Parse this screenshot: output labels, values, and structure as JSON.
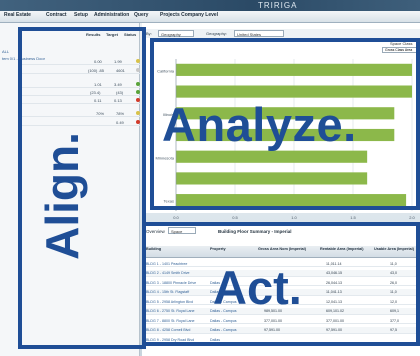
{
  "app": {
    "brand": "TRIRIGA"
  },
  "menubar": {
    "items": [
      "Real Estate",
      "Contract",
      "Setup",
      "Administration",
      "Query"
    ],
    "breadcrumb": "Projects Company Level"
  },
  "metrics_panel": {
    "columns": [
      "Results",
      "Target",
      "Status"
    ],
    "link_labels": [
      "ALL",
      "tem 0/1 - Business Door"
    ],
    "rows": [
      {
        "result": "0.00",
        "target": "1.99",
        "status_color": "#d8c24a"
      },
      {
        "result": "(100) .85",
        "target": "4601",
        "status_color": "#c8c8c8"
      },
      {
        "result": "1.01",
        "target": "3.49",
        "status_color": "#5aa33a"
      },
      {
        "result": "(23.4)",
        "target": "(43)",
        "status_color": "#5aa33a"
      },
      {
        "result": "0.11",
        "target": "0.13",
        "status_color": "#d23a2a"
      },
      {
        "result": "70%",
        "target": "78%",
        "status_color": "#d8c24a"
      },
      {
        "result": "",
        "target": "0.49",
        "status_color": "#d23a2a"
      }
    ]
  },
  "chart_panel": {
    "toolbar": {
      "filter_label": "By:",
      "filter_value": "Geography",
      "geo_label": "Geography:",
      "geo_value": "United States"
    },
    "flow_label": "Space Class",
    "flow_value": "Gross Class Area"
  },
  "chart_data": {
    "type": "bar",
    "orientation": "horizontal",
    "categories": [
      "California",
      "",
      "Illinois",
      "",
      "Minnesota",
      "",
      "Texas"
    ],
    "values": [
      2.05,
      2.0,
      1.85,
      1.85,
      1.62,
      1.62,
      1.95
    ],
    "xlim": [
      0,
      2.0
    ],
    "xticks": [
      "0.0",
      "0.5",
      "1.0",
      "1.5",
      "2.0"
    ],
    "series_color": "#8cb84a",
    "grid": true
  },
  "table_panel": {
    "view_label": "Overview",
    "view_value": "Space",
    "title": "Building Floor Summary - Imperial",
    "columns": [
      "Building",
      "Property",
      "Gross Area Nom (Imperial)",
      "Rentable Area (Imperial)",
      "Usable Area (Imperial)"
    ],
    "rows": [
      {
        "building": "BLDG 1 - 1401 Peachtree",
        "property": "",
        "gross": "",
        "rentable": "11,011.14",
        "usable": "11,0"
      },
      {
        "building": "BLDG 2 - 4149 Smith Drive",
        "property": "",
        "gross": "",
        "rentable": "43,046.15",
        "usable": "43,0"
      },
      {
        "building": "BLDG 3 - 18800 Pinnacle Drive",
        "property": "Dallas",
        "gross": "",
        "rentable": "26,044.13",
        "usable": "26,0"
      },
      {
        "building": "BLDG 4 - 15th St. Flagstaff",
        "property": "Dallas",
        "gross": "",
        "rentable": "11,041.13",
        "usable": "11,0"
      },
      {
        "building": "BLDG 5 - 2958 Arlington Blvd",
        "property": "Dallas - Campus",
        "gross": "",
        "rentable": "12,041.13",
        "usable": "12,0"
      },
      {
        "building": "BLDG 6 - 2750 St. Royal Lane",
        "property": "Dallas - Campus",
        "gross": "989,501.00",
        "rentable": "609,101.02",
        "usable": "609,1"
      },
      {
        "building": "BLDG 7 - 8800 St. Royal Lane",
        "property": "Dallas - Campus",
        "gross": "377,001.00",
        "rentable": "377,001.00",
        "usable": "377,0"
      },
      {
        "building": "BLDG 8 - 4258 Cornell Blvd",
        "property": "Dallas - Campus",
        "gross": "97,591.00",
        "rentable": "97,591.00",
        "usable": "97,5"
      },
      {
        "building": "BLDG 9 - 2958 Dry Road Blvd",
        "property": "Dallas",
        "gross": "",
        "rentable": "",
        "usable": ""
      }
    ]
  },
  "headline": {
    "align": "Align.",
    "analyze": "Analyze.",
    "act": "Act."
  },
  "colors": {
    "accent": "#1f4e96"
  }
}
